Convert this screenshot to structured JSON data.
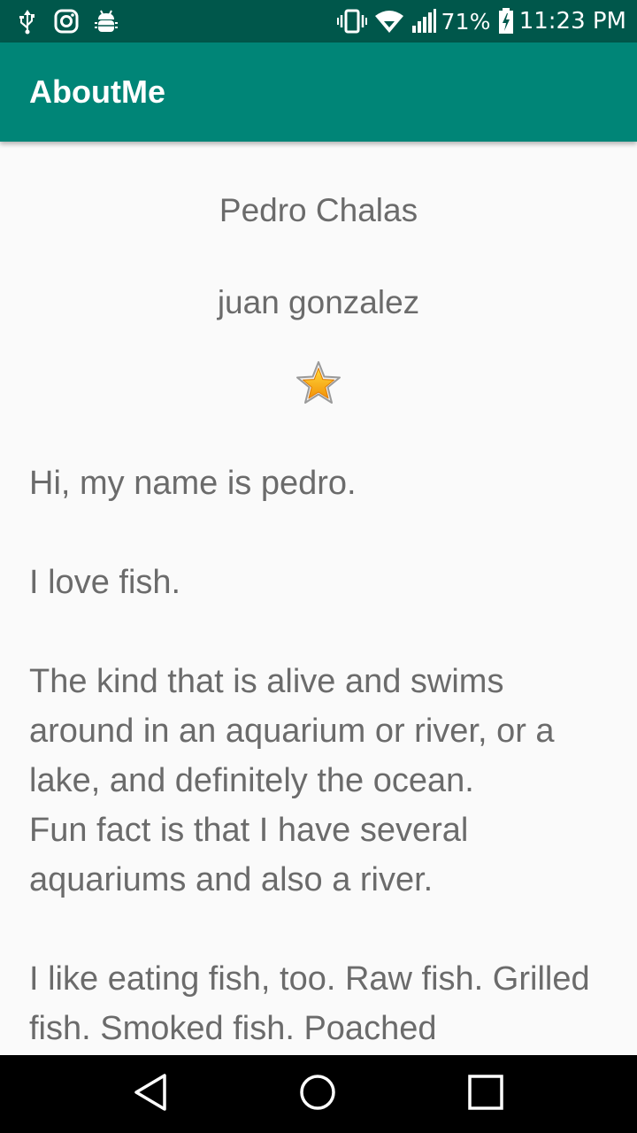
{
  "status_bar": {
    "icons_left": [
      "usb-icon",
      "instagram-icon",
      "android-debug-icon"
    ],
    "icons_right": [
      "vibrate-icon",
      "wifi-icon",
      "signal-icon",
      "battery-charging-icon"
    ],
    "battery": "71%",
    "time": "11:23 PM"
  },
  "app_bar": {
    "title": "AboutMe",
    "color": "#008577"
  },
  "profile": {
    "name": "Pedro Chalas",
    "nickname": "juan gonzalez",
    "star_icon": "yellow-star-icon"
  },
  "bio": {
    "text": "Hi, my name is pedro.\n\nI love fish.\n\nThe kind that is alive and swims around in an aquarium or river, or a lake, and definitely the ocean.\nFun fact is that I have several aquariums and also a river.\n\nI like eating fish, too. Raw fish. Grilled fish. Smoked fish. Poached"
  },
  "nav_bar": {
    "buttons": [
      "back-icon",
      "home-icon",
      "recents-icon"
    ]
  }
}
